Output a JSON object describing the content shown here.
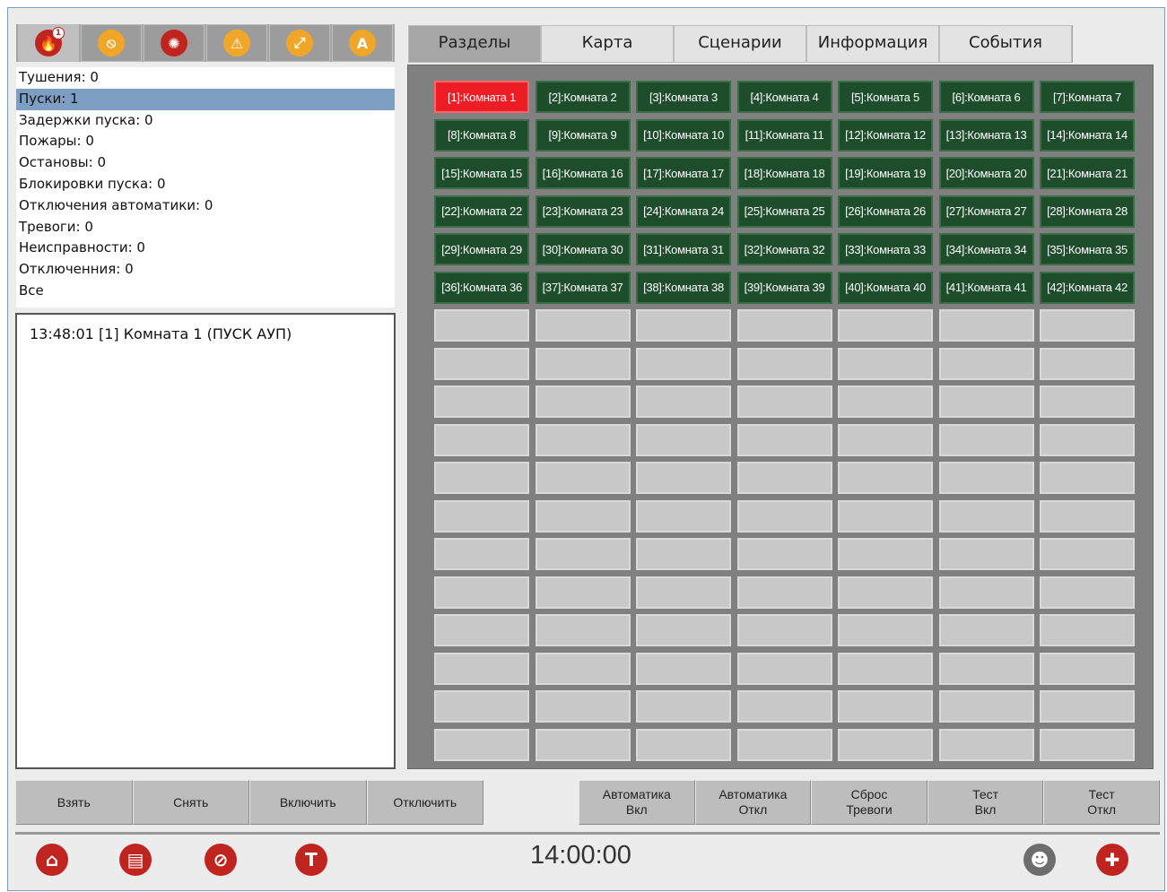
{
  "status_icons": [
    {
      "name": "fire-icon",
      "badge": "1",
      "color": "#c0241f",
      "glyph": "🔥"
    },
    {
      "name": "no-entry-icon",
      "color": "#f0a628",
      "glyph": "⦸"
    },
    {
      "name": "siren-icon",
      "color": "#c0241f",
      "glyph": "✺"
    },
    {
      "name": "warning-icon",
      "color": "#f0a628",
      "glyph": "⚠"
    },
    {
      "name": "disconnect-icon",
      "color": "#f0a628",
      "glyph": "⤢"
    },
    {
      "name": "auto-off-icon",
      "color": "#f0a628",
      "glyph": "A"
    }
  ],
  "counters": [
    {
      "label": "Тушения: 0"
    },
    {
      "label": "Пуски: 1",
      "selected": true
    },
    {
      "label": "Задержки пуска: 0"
    },
    {
      "label": "Пожары: 0"
    },
    {
      "label": "Остановы: 0"
    },
    {
      "label": "Блокировки пуска: 0"
    },
    {
      "label": "Отключения автоматики: 0"
    },
    {
      "label": "Тревоги: 0"
    },
    {
      "label": "Неисправности: 0"
    },
    {
      "label": "Отключенния: 0"
    },
    {
      "label": "Все"
    }
  ],
  "log": [
    "13:48:01 [1] Комната 1 (ПУСК АУП)"
  ],
  "tabs": [
    "Разделы",
    "Карта",
    "Сценарии",
    "Информация",
    "События"
  ],
  "active_tab": 0,
  "sections": [
    "[1]:Комната 1",
    "[2]:Комната 2",
    "[3]:Комната 3",
    "[4]:Комната 4",
    "[5]:Комната 5",
    "[6]:Комната 6",
    "[7]:Комната 7",
    "[8]:Комната 8",
    "[9]:Комната 9",
    "[10]:Комната 10",
    "[11]:Комната 11",
    "[12]:Комната 12",
    "[13]:Комната 13",
    "[14]:Комната 14",
    "[15]:Комната 15",
    "[16]:Комната 16",
    "[17]:Комната 17",
    "[18]:Комната 18",
    "[19]:Комната 19",
    "[20]:Комната 20",
    "[21]:Комната 21",
    "[22]:Комната 22",
    "[23]:Комната 23",
    "[24]:Комната 24",
    "[25]:Комната 25",
    "[26]:Комната 26",
    "[27]:Комната 27",
    "[28]:Комната 28",
    "[29]:Комната 29",
    "[30]:Комната 30",
    "[31]:Комната 31",
    "[32]:Комната 32",
    "[33]:Комната 33",
    "[34]:Комната 34",
    "[35]:Комната 35",
    "[36]:Комната 36",
    "[37]:Комната 37",
    "[38]:Комната 38",
    "[39]:Комната 39",
    "[40]:Комната 40",
    "[41]:Комната 41",
    "[42]:Комната 42"
  ],
  "alarm_section_index": 0,
  "empty_rows": 12,
  "columns": 7,
  "left_buttons": [
    "Взять",
    "Снять",
    "Включить",
    "Отключить"
  ],
  "right_buttons": [
    "Автоматика\nВкл",
    "Автоматика\nОткл",
    "Сброс\nТревоги",
    "Тест\nВкл",
    "Тест\nОткл"
  ],
  "clock": "14:00:00",
  "footer_icons": [
    {
      "name": "home-icon",
      "glyph": "⌂",
      "color": "#c0241f"
    },
    {
      "name": "clipboard-icon",
      "glyph": "▤",
      "color": "#c0241f"
    },
    {
      "name": "sound-off-icon",
      "glyph": "⊘",
      "color": "#c0241f"
    },
    {
      "name": "stop-icon",
      "glyph": "T",
      "color": "#c0241f"
    },
    {
      "name": "users-icon",
      "glyph": "☻",
      "color": "#6d6d6d"
    },
    {
      "name": "lifebuoy-icon",
      "glyph": "✚",
      "color": "#c0241f"
    }
  ],
  "colors": {
    "alarm": "#ee1c25",
    "normal": "#1d4d2a",
    "empty": "#c8c8c8",
    "selected_row": "#7d9fc4"
  }
}
